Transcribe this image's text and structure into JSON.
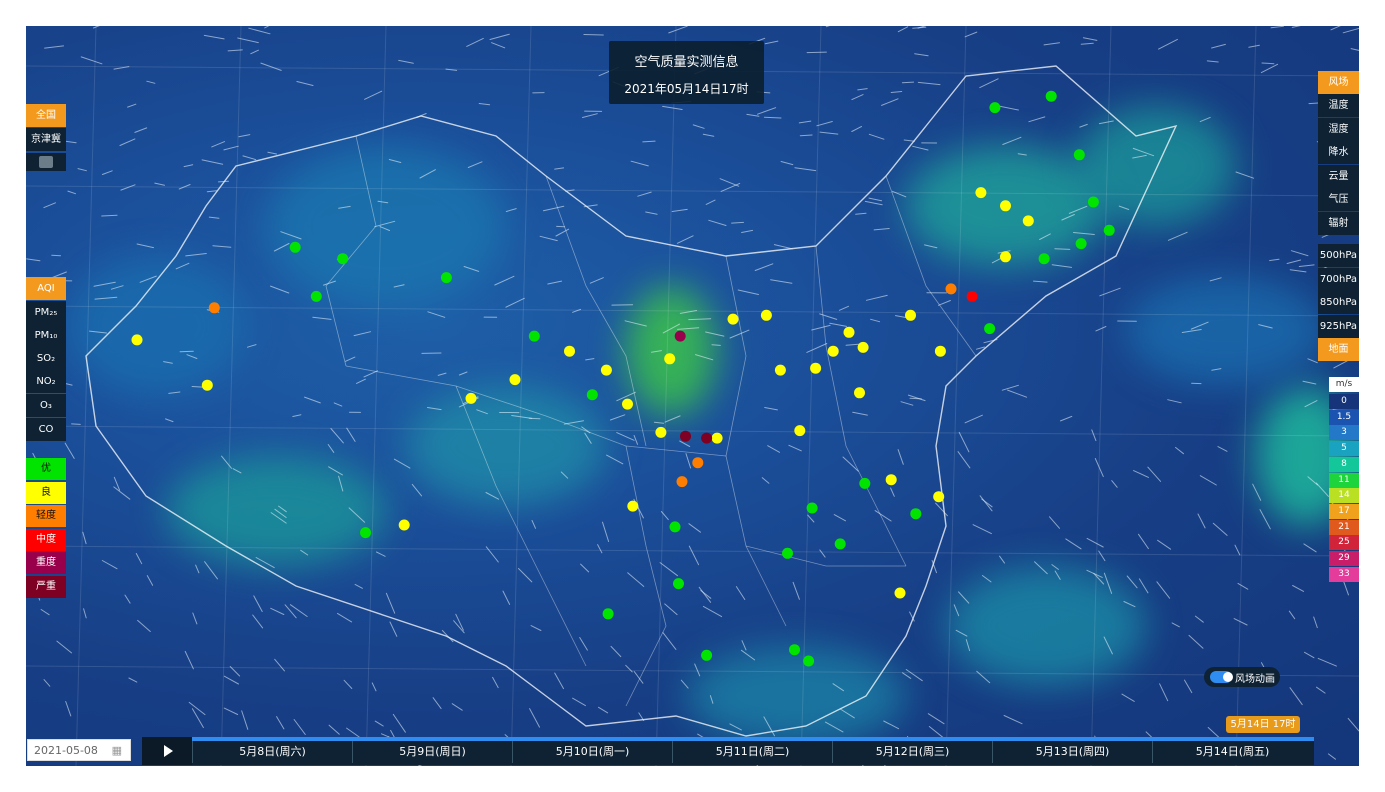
{
  "title_panel": {
    "title": "空气质量实测信息",
    "datetime": "2021年05月14日17时"
  },
  "region_buttons": [
    {
      "label": "全国",
      "active": true
    },
    {
      "label": "京津冀",
      "active": false
    }
  ],
  "pollutant_buttons": [
    {
      "label": "AQI",
      "active": true
    },
    {
      "label": "PM₂₅",
      "active": false
    },
    {
      "label": "PM₁₀",
      "active": false
    },
    {
      "label": "SO₂",
      "active": false
    },
    {
      "label": "NO₂",
      "active": false
    },
    {
      "label": "O₃",
      "active": false
    },
    {
      "label": "CO",
      "active": false
    }
  ],
  "aqi_legend": [
    {
      "label": "优",
      "color": "#00e400"
    },
    {
      "label": "良",
      "color": "#ffff00"
    },
    {
      "label": "轻度",
      "color": "#ff7e00"
    },
    {
      "label": "中度",
      "color": "#ff0000"
    },
    {
      "label": "重度",
      "color": "#99004c"
    },
    {
      "label": "严重",
      "color": "#7e0023"
    }
  ],
  "layer_buttons": [
    {
      "label": "风场",
      "active": true
    },
    {
      "label": "温度",
      "active": false
    },
    {
      "label": "湿度",
      "active": false
    },
    {
      "label": "降水",
      "active": false
    },
    {
      "label": "云量",
      "active": false
    },
    {
      "label": "气压",
      "active": false
    },
    {
      "label": "辐射",
      "active": false
    }
  ],
  "level_buttons": [
    {
      "label": "500hPa",
      "active": false
    },
    {
      "label": "700hPa",
      "active": false
    },
    {
      "label": "850hPa",
      "active": false
    },
    {
      "label": "925hPa",
      "active": false
    },
    {
      "label": "地面",
      "active": true
    }
  ],
  "wind_scale": {
    "unit": "m/s",
    "levels": [
      {
        "label": "0",
        "color": "#16347a"
      },
      {
        "label": "1.5",
        "color": "#1b54b0"
      },
      {
        "label": "3",
        "color": "#2378c8"
      },
      {
        "label": "5",
        "color": "#1aa3c0"
      },
      {
        "label": "8",
        "color": "#14c79a"
      },
      {
        "label": "11",
        "color": "#1ed43c"
      },
      {
        "label": "14",
        "color": "#b9e022"
      },
      {
        "label": "17",
        "color": "#f0a21c"
      },
      {
        "label": "21",
        "color": "#e05a1e"
      },
      {
        "label": "25",
        "color": "#d1233a"
      },
      {
        "label": "29",
        "color": "#c81e6a"
      },
      {
        "label": "33",
        "color": "#e43c9a"
      }
    ]
  },
  "wind_animation_toggle": {
    "label": "风场动画",
    "on": true
  },
  "date_input": {
    "value": "2021-05-08"
  },
  "current_time_badge": "5月14日 17时",
  "timeline_days": [
    "5月8日(周六)",
    "5月9日(周日)",
    "5月10日(周一)",
    "5月11日(周二)",
    "5月12日(周三)",
    "5月13日(周四)",
    "5月14日(周五)"
  ],
  "stations": [
    {
      "lon": 127.9,
      "lat": 52.4,
      "aqi": "优"
    },
    {
      "lon": 124.7,
      "lat": 51.8,
      "aqi": "优"
    },
    {
      "lon": 129.5,
      "lat": 49.3,
      "aqi": "优"
    },
    {
      "lon": 126.6,
      "lat": 45.8,
      "aqi": "良"
    },
    {
      "lon": 125.3,
      "lat": 46.6,
      "aqi": "良"
    },
    {
      "lon": 123.9,
      "lat": 47.3,
      "aqi": "良"
    },
    {
      "lon": 130.3,
      "lat": 46.8,
      "aqi": "优"
    },
    {
      "lon": 131.2,
      "lat": 45.3,
      "aqi": "优"
    },
    {
      "lon": 129.6,
      "lat": 44.6,
      "aqi": "优"
    },
    {
      "lon": 127.5,
      "lat": 43.8,
      "aqi": "优"
    },
    {
      "lon": 125.3,
      "lat": 43.9,
      "aqi": "良"
    },
    {
      "lon": 123.4,
      "lat": 41.8,
      "aqi": "中度"
    },
    {
      "lon": 122.2,
      "lat": 42.2,
      "aqi": "轻度"
    },
    {
      "lon": 121.6,
      "lat": 38.9,
      "aqi": "良"
    },
    {
      "lon": 124.4,
      "lat": 40.1,
      "aqi": "优"
    },
    {
      "lon": 119.9,
      "lat": 40.8,
      "aqi": "良"
    },
    {
      "lon": 117.2,
      "lat": 39.1,
      "aqi": "良"
    },
    {
      "lon": 116.4,
      "lat": 39.9,
      "aqi": "良"
    },
    {
      "lon": 114.5,
      "lat": 38.0,
      "aqi": "良"
    },
    {
      "lon": 115.5,
      "lat": 38.9,
      "aqi": "良"
    },
    {
      "lon": 112.5,
      "lat": 37.9,
      "aqi": "良"
    },
    {
      "lon": 111.7,
      "lat": 40.8,
      "aqi": "良"
    },
    {
      "lon": 109.8,
      "lat": 40.6,
      "aqi": "良"
    },
    {
      "lon": 106.8,
      "lat": 39.7,
      "aqi": "重度"
    },
    {
      "lon": 106.2,
      "lat": 38.5,
      "aqi": "良"
    },
    {
      "lon": 103.8,
      "lat": 36.1,
      "aqi": "良"
    },
    {
      "lon": 108.9,
      "lat": 34.3,
      "aqi": "良"
    },
    {
      "lon": 105.7,
      "lat": 34.6,
      "aqi": "良"
    },
    {
      "lon": 107.1,
      "lat": 34.4,
      "aqi": "严重"
    },
    {
      "lon": 108.3,
      "lat": 34.3,
      "aqi": "严重"
    },
    {
      "lon": 106.9,
      "lat": 32.0,
      "aqi": "轻度"
    },
    {
      "lon": 107.8,
      "lat": 33.0,
      "aqi": "轻度"
    },
    {
      "lon": 113.6,
      "lat": 34.7,
      "aqi": "良"
    },
    {
      "lon": 117.0,
      "lat": 36.7,
      "aqi": "良"
    },
    {
      "lon": 118.8,
      "lat": 32.1,
      "aqi": "良"
    },
    {
      "lon": 121.5,
      "lat": 31.2,
      "aqi": "良"
    },
    {
      "lon": 120.2,
      "lat": 30.3,
      "aqi": "优"
    },
    {
      "lon": 117.3,
      "lat": 31.9,
      "aqi": "优"
    },
    {
      "lon": 114.3,
      "lat": 30.6,
      "aqi": "优"
    },
    {
      "lon": 112.9,
      "lat": 28.2,
      "aqi": "优"
    },
    {
      "lon": 115.9,
      "lat": 28.7,
      "aqi": "优"
    },
    {
      "lon": 119.3,
      "lat": 26.1,
      "aqi": "良"
    },
    {
      "lon": 113.3,
      "lat": 23.1,
      "aqi": "优"
    },
    {
      "lon": 114.1,
      "lat": 22.5,
      "aqi": "优"
    },
    {
      "lon": 108.3,
      "lat": 22.8,
      "aqi": "优"
    },
    {
      "lon": 106.7,
      "lat": 26.6,
      "aqi": "优"
    },
    {
      "lon": 102.7,
      "lat": 25.0,
      "aqi": "优"
    },
    {
      "lon": 104.1,
      "lat": 30.7,
      "aqi": "良"
    },
    {
      "lon": 106.5,
      "lat": 29.6,
      "aqi": "优"
    },
    {
      "lon": 101.8,
      "lat": 36.6,
      "aqi": "优"
    },
    {
      "lon": 91.1,
      "lat": 29.7,
      "aqi": "良"
    },
    {
      "lon": 87.6,
      "lat": 43.8,
      "aqi": "优"
    },
    {
      "lon": 79.9,
      "lat": 37.1,
      "aqi": "良"
    },
    {
      "lon": 75.9,
      "lat": 39.5,
      "aqi": "良"
    },
    {
      "lon": 84.9,
      "lat": 44.4,
      "aqi": "优"
    },
    {
      "lon": 86.1,
      "lat": 41.8,
      "aqi": "优"
    },
    {
      "lon": 93.5,
      "lat": 42.8,
      "aqi": "优"
    },
    {
      "lon": 80.3,
      "lat": 41.2,
      "aqi": "轻度"
    },
    {
      "lon": 98.5,
      "lat": 39.7,
      "aqi": "优"
    },
    {
      "lon": 97.4,
      "lat": 37.4,
      "aqi": "良"
    },
    {
      "lon": 100.5,
      "lat": 38.9,
      "aqi": "良"
    },
    {
      "lon": 94.9,
      "lat": 36.4,
      "aqi": "良"
    },
    {
      "lon": 102.6,
      "lat": 37.9,
      "aqi": "良"
    },
    {
      "lon": 88.9,
      "lat": 29.3,
      "aqi": "优"
    }
  ]
}
